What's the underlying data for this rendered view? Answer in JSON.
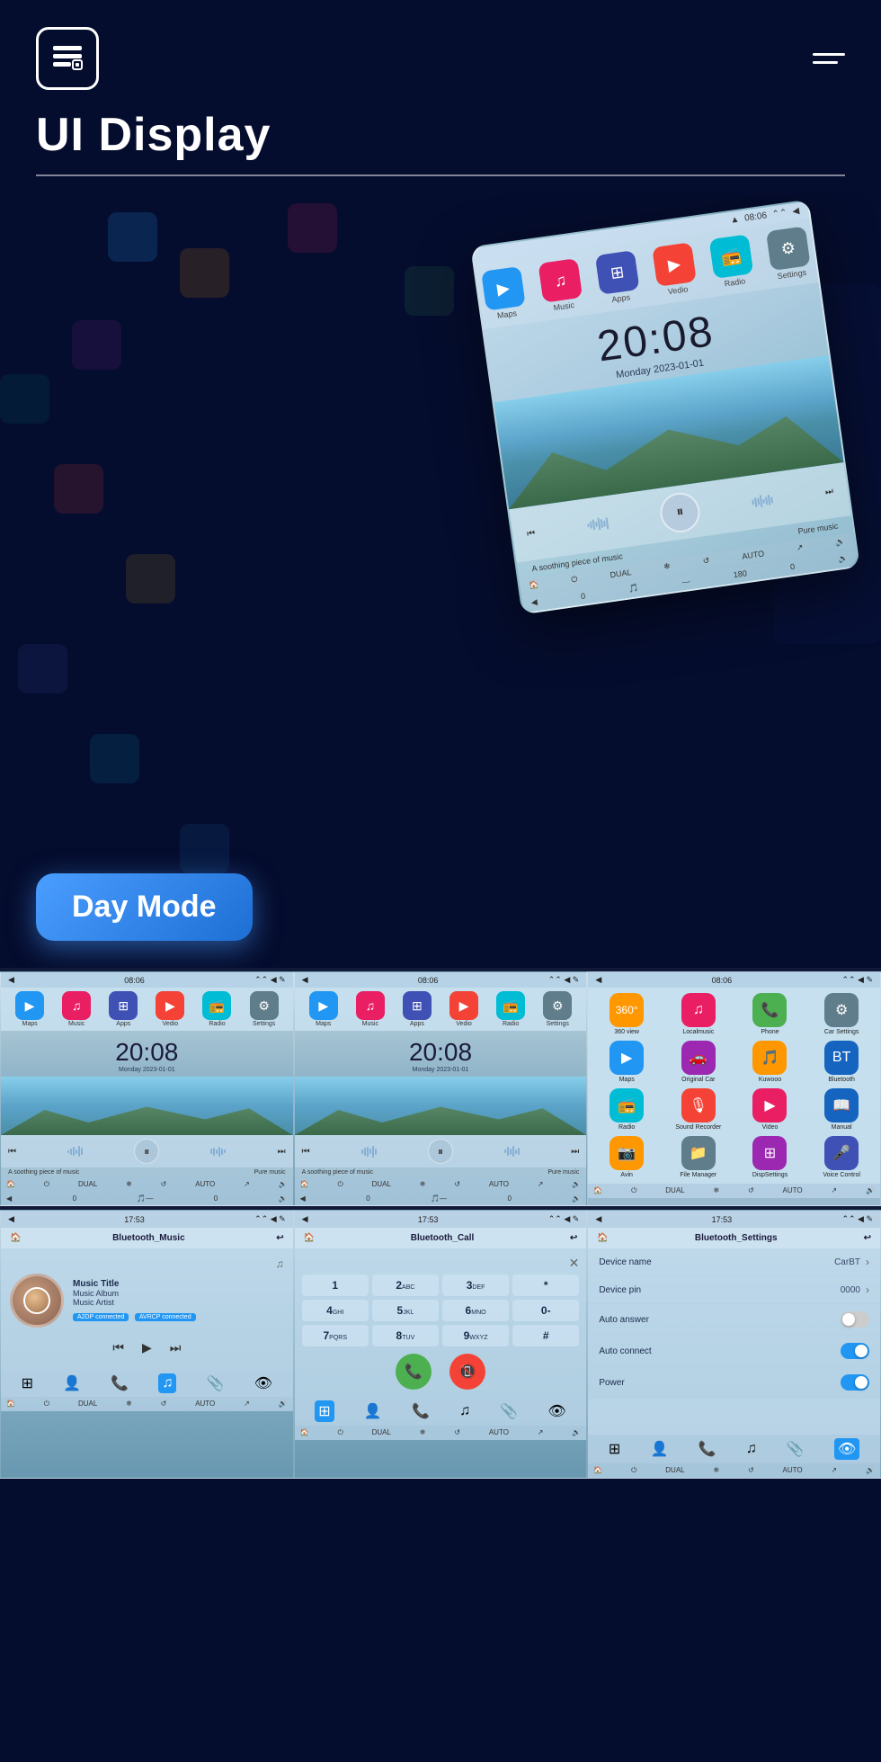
{
  "header": {
    "title": "UI Display",
    "logo_symbol": "☰",
    "hamburger_label": "menu"
  },
  "hero": {
    "day_mode_label": "Day Mode",
    "phone_clock": "20:08",
    "phone_date": "Monday  2023-01-01",
    "music_text": "A soothing piece of music",
    "pure_music": "Pure music",
    "status_time": "08:06",
    "apps": [
      {
        "label": "Maps",
        "color": "#2196F3",
        "icon": "▶"
      },
      {
        "label": "Music",
        "color": "#e91e63",
        "icon": "♫"
      },
      {
        "label": "Apps",
        "color": "#3F51B5",
        "icon": "⊞"
      },
      {
        "label": "Vedio",
        "color": "#f44336",
        "icon": "▶"
      },
      {
        "label": "Radio",
        "color": "#00BCD4",
        "icon": "📻"
      },
      {
        "label": "Settings",
        "color": "#607D8B",
        "icon": "⚙"
      }
    ]
  },
  "screens_row1": [
    {
      "id": "screen1",
      "time": "08:06",
      "clock": "20:08",
      "date": "Monday  2023-01-01",
      "music": "A soothing piece of music",
      "pure": "Pure music"
    },
    {
      "id": "screen2",
      "time": "08:06",
      "clock": "20:08",
      "date": "Monday  2023-01-01",
      "music": "A soothing piece of music",
      "pure": "Pure music"
    },
    {
      "id": "screen3",
      "time": "08:06",
      "apps": [
        {
          "label": "360 view",
          "color": "#FF9800",
          "icon": "🔄"
        },
        {
          "label": "Localmusic",
          "color": "#e91e63",
          "icon": "♫"
        },
        {
          "label": "Phone",
          "color": "#4CAF50",
          "icon": "📞"
        },
        {
          "label": "Car Settings",
          "color": "#607D8B",
          "icon": "⚙"
        },
        {
          "label": "Maps",
          "color": "#2196F3",
          "icon": "▶"
        },
        {
          "label": "Original Car",
          "color": "#9C27B0",
          "icon": "🚗"
        },
        {
          "label": "Kuwooo",
          "color": "#FF9800",
          "icon": "🎵"
        },
        {
          "label": "Bluetooth",
          "color": "#1565C0",
          "icon": "🔵"
        },
        {
          "label": "Radio",
          "color": "#00BCD4",
          "icon": "📻"
        },
        {
          "label": "Sound Recorder",
          "color": "#f44336",
          "icon": "🎙"
        },
        {
          "label": "Video",
          "color": "#e91e63",
          "icon": "▶"
        },
        {
          "label": "Manual",
          "color": "#1565C0",
          "icon": "📖"
        },
        {
          "label": "Avin",
          "color": "#FF9800",
          "icon": "📷"
        },
        {
          "label": "File Manager",
          "color": "#607D8B",
          "icon": "📁"
        },
        {
          "label": "DispSettings",
          "color": "#9C27B0",
          "icon": "⊞"
        },
        {
          "label": "Voice Control",
          "color": "#3F51B5",
          "icon": "🎤"
        }
      ]
    }
  ],
  "screens_row2": [
    {
      "id": "bt_music",
      "time": "17:53",
      "title": "Bluetooth_Music",
      "track_title": "Music Title",
      "track_album": "Music Album",
      "track_artist": "Music Artist",
      "tag1": "A2DP connected",
      "tag2": "AVRCP connected"
    },
    {
      "id": "bt_call",
      "time": "17:53",
      "title": "Bluetooth_Call"
    },
    {
      "id": "bt_settings",
      "time": "17:53",
      "title": "Bluetooth_Settings",
      "device_name_label": "Device name",
      "device_name_value": "CarBT",
      "device_pin_label": "Device pin",
      "device_pin_value": "0000",
      "auto_answer_label": "Auto answer",
      "auto_connect_label": "Auto connect",
      "power_label": "Power"
    }
  ],
  "dialpad": {
    "keys": [
      "1",
      "2ABC",
      "3DEF",
      "*",
      "4GHI",
      "5JKL",
      "6MNO",
      "0-",
      "7PQRS",
      "8TUV",
      "9WXYZ",
      "#"
    ]
  },
  "bottom_nav_items": [
    "⊞",
    "👤",
    "📞",
    "♫",
    "📎",
    "👁"
  ],
  "status_icons": [
    "◀",
    "🔊",
    "⚙",
    "❄",
    "↺",
    "AUTO",
    "↗"
  ],
  "colors": {
    "accent_blue": "#2196F3",
    "brand_bg": "#050d2e",
    "day_mode_gradient": "linear-gradient(135deg, #4a9eff, #1e6fd4)"
  }
}
